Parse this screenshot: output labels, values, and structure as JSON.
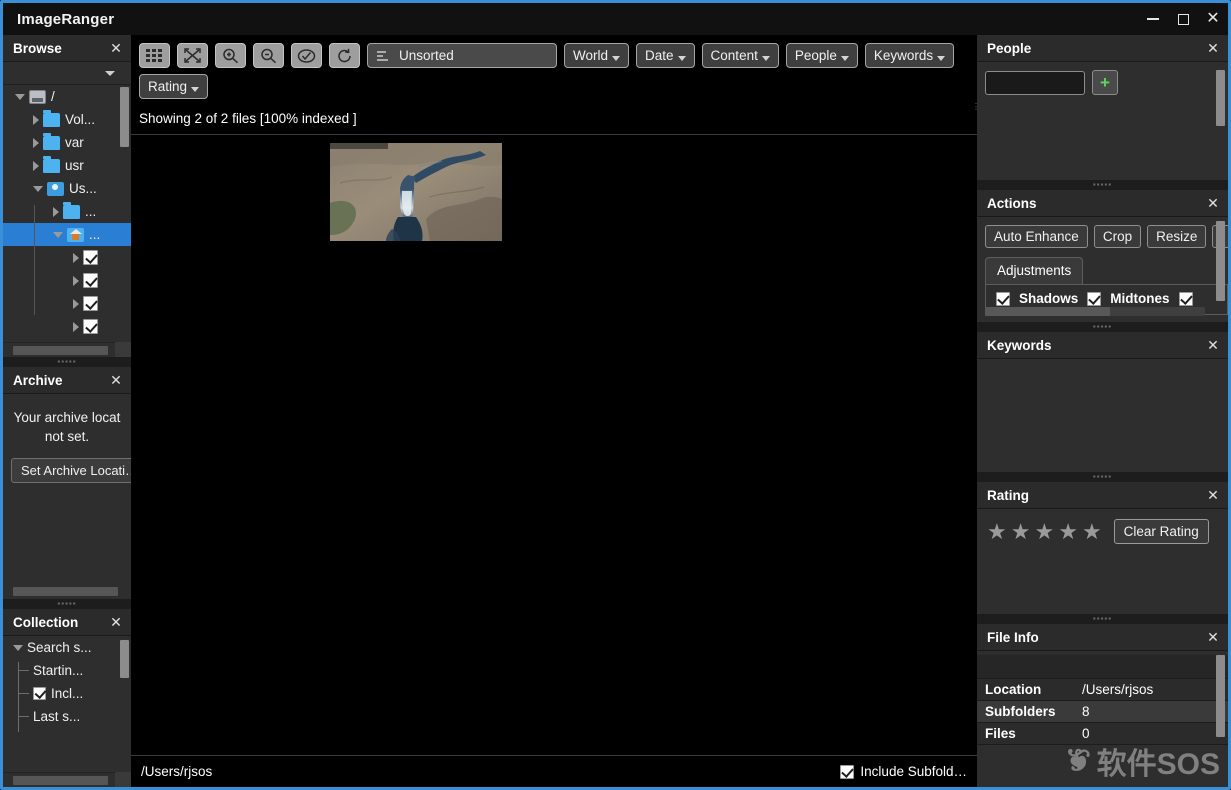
{
  "window": {
    "title": "ImageRanger",
    "minimize_label": "Minimize",
    "maximize_label": "Maximize",
    "close_label": "Close",
    "accent_color": "#3b8fd6"
  },
  "browse": {
    "title": "Browse",
    "close_label": "✕",
    "tree": [
      {
        "label": "/",
        "icon": "disk-icon",
        "indent": 0,
        "state": "expanded",
        "selected": false
      },
      {
        "label": "Vol...",
        "icon": "folder-icon",
        "indent": 1,
        "state": "collapsed",
        "selected": false
      },
      {
        "label": "var",
        "icon": "folder-icon",
        "indent": 1,
        "state": "collapsed",
        "selected": false
      },
      {
        "label": "usr",
        "icon": "folder-icon",
        "indent": 1,
        "state": "collapsed",
        "selected": false
      },
      {
        "label": "Us...",
        "icon": "users-icon",
        "indent": 1,
        "state": "expanded",
        "selected": false
      },
      {
        "label": "...",
        "icon": "folder-icon",
        "indent": 2,
        "state": "collapsed",
        "selected": false
      },
      {
        "label": "...",
        "icon": "home-icon",
        "indent": 2,
        "state": "expanded",
        "selected": true
      },
      {
        "label": "",
        "icon": "checkbox-icon",
        "indent": 3,
        "state": "collapsed",
        "selected": false
      },
      {
        "label": "",
        "icon": "checkbox-icon",
        "indent": 3,
        "state": "collapsed",
        "selected": false
      },
      {
        "label": "",
        "icon": "checkbox-icon",
        "indent": 3,
        "state": "collapsed",
        "selected": false
      },
      {
        "label": "",
        "icon": "checkbox-icon",
        "indent": 3,
        "state": "collapsed",
        "selected": false
      }
    ]
  },
  "archive": {
    "title": "Archive",
    "close_label": "✕",
    "message_line1": "Your archive locat",
    "message_line2": "not set.",
    "set_location_label": "Set Archive Locati…"
  },
  "collection": {
    "title": "Collection",
    "close_label": "✕",
    "items": [
      {
        "label": "Search s...",
        "type": "root"
      },
      {
        "label": "Startin...",
        "type": "child"
      },
      {
        "label": "Incl...",
        "type": "checkbox"
      },
      {
        "label": "Last s...",
        "type": "child"
      }
    ]
  },
  "toolbar": {
    "icons": [
      {
        "name": "grid-view-icon",
        "label": "Grid view"
      },
      {
        "name": "fullscreen-icon",
        "label": "Fullscreen"
      },
      {
        "name": "zoom-in-icon",
        "label": "Zoom in"
      },
      {
        "name": "zoom-out-icon",
        "label": "Zoom out"
      },
      {
        "name": "select-check-icon",
        "label": "Select"
      },
      {
        "name": "refresh-icon",
        "label": "Refresh"
      }
    ],
    "sort_value": "Unsorted",
    "sort_icon": "sort-list-icon",
    "filters": [
      {
        "label": "World"
      },
      {
        "label": "Date"
      },
      {
        "label": "Content"
      },
      {
        "label": "People"
      },
      {
        "label": "Keywords"
      },
      {
        "label": "Rating"
      }
    ]
  },
  "content": {
    "status_line": "Showing 2 of 2 files [100% indexed ]",
    "thumbnail_alt": "aerial-waterfall-photo"
  },
  "statusbar": {
    "path": "/Users/rjsos",
    "include_subfolders_label": "Include Subfold…",
    "include_subfolders_checked": true
  },
  "people": {
    "title": "People",
    "close_label": "✕",
    "input_value": "",
    "input_placeholder": "",
    "add_label": "+"
  },
  "actions": {
    "title": "Actions",
    "close_label": "✕",
    "buttons": [
      {
        "label": "Auto Enhance"
      },
      {
        "label": "Crop"
      },
      {
        "label": "Resize"
      }
    ],
    "tab_label": "Adjustments",
    "checkboxes": [
      {
        "label": "Shadows",
        "checked": true
      },
      {
        "label": "Midtones",
        "checked": true
      },
      {
        "label": "",
        "checked": true
      }
    ]
  },
  "keywords": {
    "title": "Keywords",
    "close_label": "✕"
  },
  "rating": {
    "title": "Rating",
    "close_label": "✕",
    "stars": 5,
    "star_glyph": "★",
    "clear_label": "Clear Rating"
  },
  "file_info": {
    "title": "File Info",
    "close_label": "✕",
    "rows": [
      {
        "key": "Location",
        "value": "/Users/rjsos"
      },
      {
        "key": "Subfolders",
        "value": "8"
      },
      {
        "key": "Files",
        "value": "0"
      }
    ]
  },
  "watermark": {
    "logo": "❦",
    "text": "软件SOS"
  }
}
